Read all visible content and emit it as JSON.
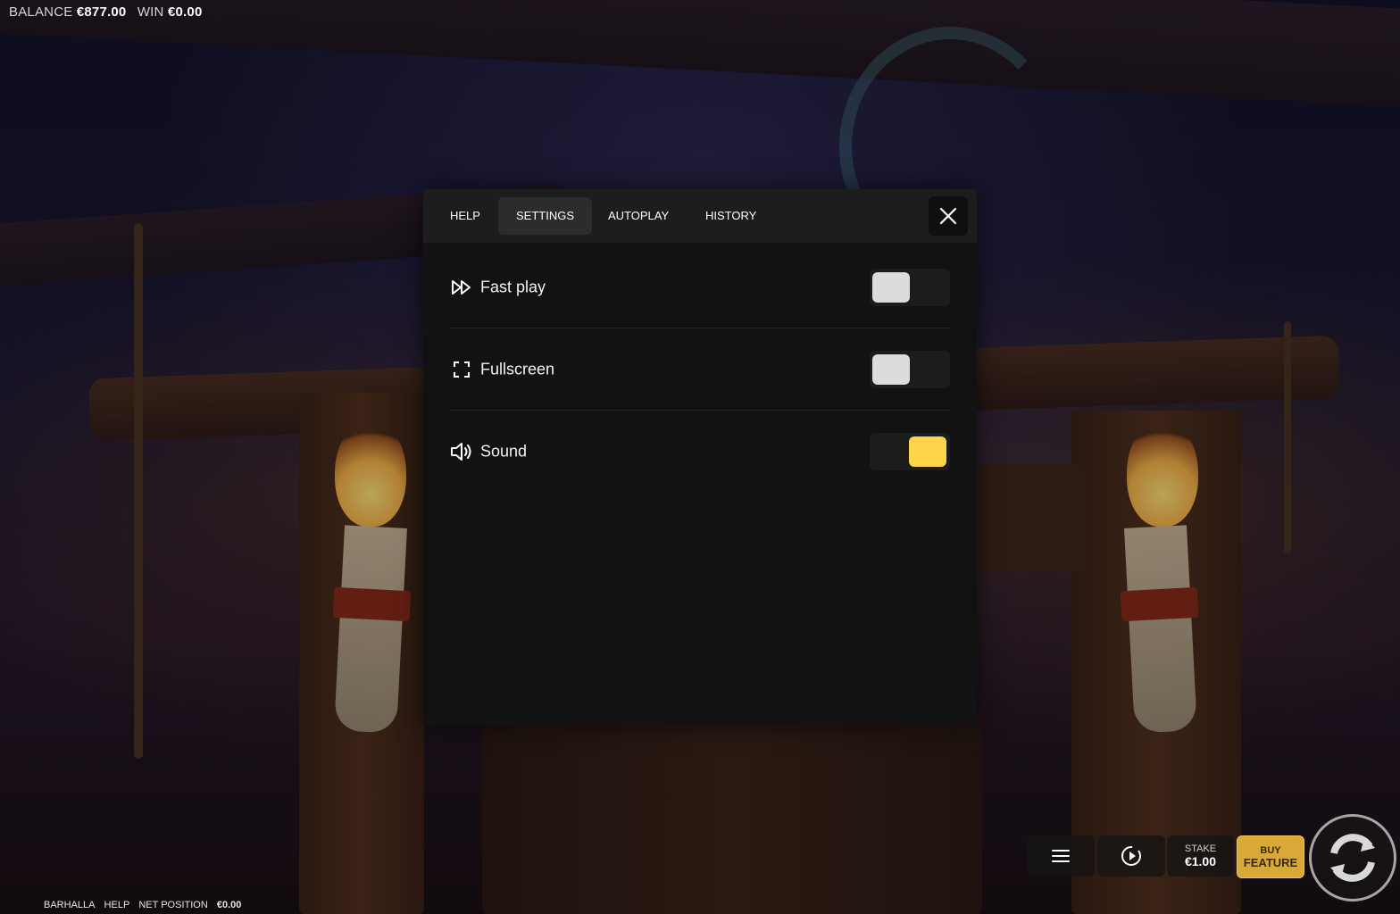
{
  "status": {
    "balance_label": "BALANCE",
    "balance_value": "€877.00",
    "win_label": "WIN",
    "win_value": "€0.00"
  },
  "modal": {
    "tabs": [
      {
        "label": "HELP",
        "active": false
      },
      {
        "label": "SETTINGS",
        "active": true
      },
      {
        "label": "AUTOPLAY",
        "active": false
      },
      {
        "label": "HISTORY",
        "active": false
      }
    ],
    "close_icon": "close-icon",
    "settings": [
      {
        "label": "Fast play",
        "icon": "fast-forward-icon",
        "enabled": false
      },
      {
        "label": "Fullscreen",
        "icon": "fullscreen-icon",
        "enabled": false
      },
      {
        "label": "Sound",
        "icon": "speaker-icon",
        "enabled": true
      }
    ]
  },
  "controls": {
    "menu_icon": "hamburger-menu-icon",
    "autoplay_icon": "autoplay-icon",
    "stake_label": "STAKE",
    "stake_value": "€1.00",
    "buy_label": "BUY",
    "buy_feature_label": "FEATURE",
    "spin_icon": "spin-icon",
    "accent_color": "#fed449"
  },
  "footer": {
    "game_name": "BARHALLA",
    "help": "HELP",
    "net_position_label": "NET POSITION",
    "net_position_value": "€0.00"
  }
}
